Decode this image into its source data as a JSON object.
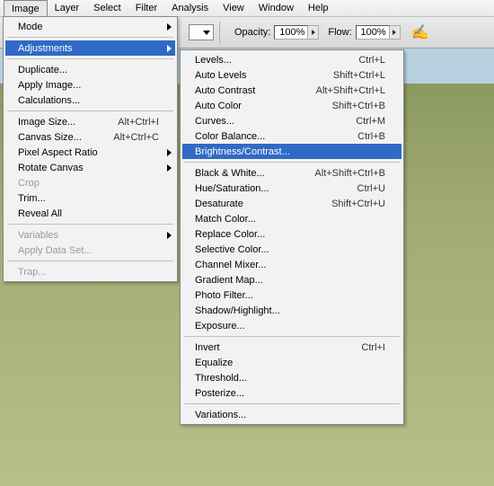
{
  "menubar": {
    "items": [
      "Image",
      "Layer",
      "Select",
      "Filter",
      "Analysis",
      "View",
      "Window",
      "Help"
    ],
    "active_index": 0
  },
  "toolbar": {
    "opacity_label": "Opacity:",
    "opacity_value": "100%",
    "flow_label": "Flow:",
    "flow_value": "100%"
  },
  "image_menu": [
    {
      "label": "Mode",
      "submenu": true
    },
    {
      "sep": true
    },
    {
      "label": "Adjustments",
      "submenu": true,
      "highlight": true
    },
    {
      "sep": true
    },
    {
      "label": "Duplicate..."
    },
    {
      "label": "Apply Image..."
    },
    {
      "label": "Calculations..."
    },
    {
      "sep": true
    },
    {
      "label": "Image Size...",
      "shortcut": "Alt+Ctrl+I"
    },
    {
      "label": "Canvas Size...",
      "shortcut": "Alt+Ctrl+C"
    },
    {
      "label": "Pixel Aspect Ratio",
      "submenu": true
    },
    {
      "label": "Rotate Canvas",
      "submenu": true
    },
    {
      "label": "Crop",
      "disabled": true
    },
    {
      "label": "Trim..."
    },
    {
      "label": "Reveal All"
    },
    {
      "sep": true
    },
    {
      "label": "Variables",
      "submenu": true,
      "disabled": true
    },
    {
      "label": "Apply Data Set...",
      "disabled": true
    },
    {
      "sep": true
    },
    {
      "label": "Trap...",
      "disabled": true
    }
  ],
  "adjustments_menu": [
    {
      "label": "Levels...",
      "shortcut": "Ctrl+L"
    },
    {
      "label": "Auto Levels",
      "shortcut": "Shift+Ctrl+L"
    },
    {
      "label": "Auto Contrast",
      "shortcut": "Alt+Shift+Ctrl+L"
    },
    {
      "label": "Auto Color",
      "shortcut": "Shift+Ctrl+B"
    },
    {
      "label": "Curves...",
      "shortcut": "Ctrl+M"
    },
    {
      "label": "Color Balance...",
      "shortcut": "Ctrl+B"
    },
    {
      "label": "Brightness/Contrast...",
      "highlight": true
    },
    {
      "sep": true
    },
    {
      "label": "Black & White...",
      "shortcut": "Alt+Shift+Ctrl+B"
    },
    {
      "label": "Hue/Saturation...",
      "shortcut": "Ctrl+U"
    },
    {
      "label": "Desaturate",
      "shortcut": "Shift+Ctrl+U"
    },
    {
      "label": "Match Color..."
    },
    {
      "label": "Replace Color..."
    },
    {
      "label": "Selective Color..."
    },
    {
      "label": "Channel Mixer..."
    },
    {
      "label": "Gradient Map..."
    },
    {
      "label": "Photo Filter..."
    },
    {
      "label": "Shadow/Highlight..."
    },
    {
      "label": "Exposure..."
    },
    {
      "sep": true
    },
    {
      "label": "Invert",
      "shortcut": "Ctrl+I"
    },
    {
      "label": "Equalize"
    },
    {
      "label": "Threshold..."
    },
    {
      "label": "Posterize..."
    },
    {
      "sep": true
    },
    {
      "label": "Variations..."
    }
  ]
}
